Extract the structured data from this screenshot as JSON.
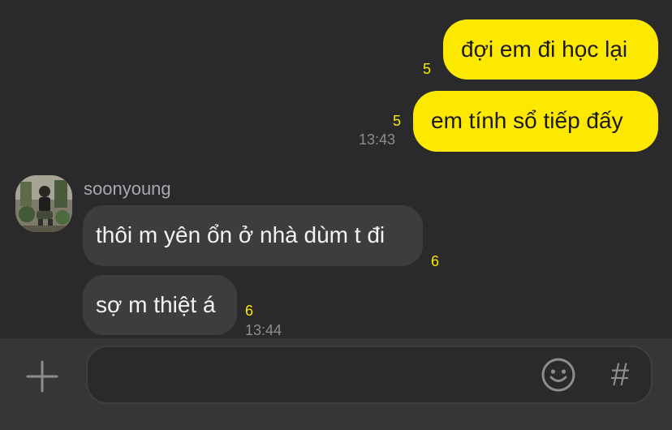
{
  "messages": {
    "mine": [
      {
        "text": "đợi em đi học lại",
        "unread": "5"
      },
      {
        "text": "em tính sổ tiếp đấy",
        "unread": "5",
        "time": "13:43"
      }
    ],
    "sender_name": "soonyoung",
    "theirs": [
      {
        "text": "thôi m yên ổn ở nhà dùm t đi",
        "unread": "6"
      },
      {
        "text": "sợ m thiệt á",
        "unread": "6",
        "time": "13:44"
      }
    ]
  },
  "composer": {
    "input_value": "",
    "hash_label": "#"
  },
  "icons": {
    "add": "plus-icon",
    "emoji": "smiley-icon",
    "avatar": "profile-photo"
  },
  "colors": {
    "background": "#2a2a2c",
    "my_bubble": "#fde900",
    "their_bubble": "#3d3d40",
    "unread_count": "#fde900",
    "timestamp": "#8d8d90"
  }
}
